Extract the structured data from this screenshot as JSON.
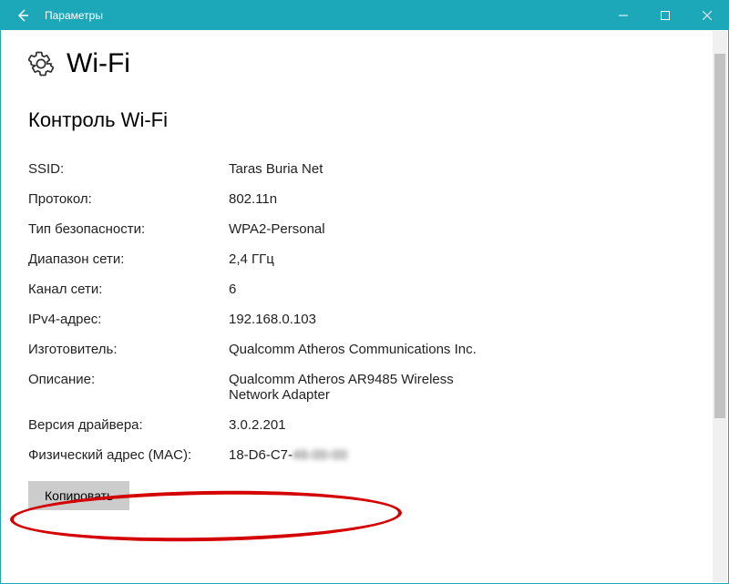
{
  "titlebar": {
    "title": "Параметры"
  },
  "page": {
    "heading": "Wi-Fi",
    "section": "Контроль Wi-Fi"
  },
  "props": {
    "ssid_label": "SSID:",
    "ssid_value": "Taras Buria Net",
    "protocol_label": "Протокол:",
    "protocol_value": "802.11n",
    "security_label": "Тип безопасности:",
    "security_value": "WPA2-Personal",
    "band_label": "Диапазон сети:",
    "band_value": "2,4 ГГц",
    "channel_label": "Канал сети:",
    "channel_value": "6",
    "ipv4_label": "IPv4-адрес:",
    "ipv4_value": "192.168.0.103",
    "vendor_label": "Изготовитель:",
    "vendor_value": "Qualcomm Atheros Communications Inc.",
    "desc_label": "Описание:",
    "desc_value": "Qualcomm Atheros AR9485 Wireless Network Adapter",
    "driver_label": "Версия драйвера:",
    "driver_value": "3.0.2.201",
    "mac_label": "Физический адрес (MAC):",
    "mac_value_visible": "18-D6-C7-",
    "mac_value_hidden": "46-00-00"
  },
  "actions": {
    "copy": "Копировать"
  }
}
